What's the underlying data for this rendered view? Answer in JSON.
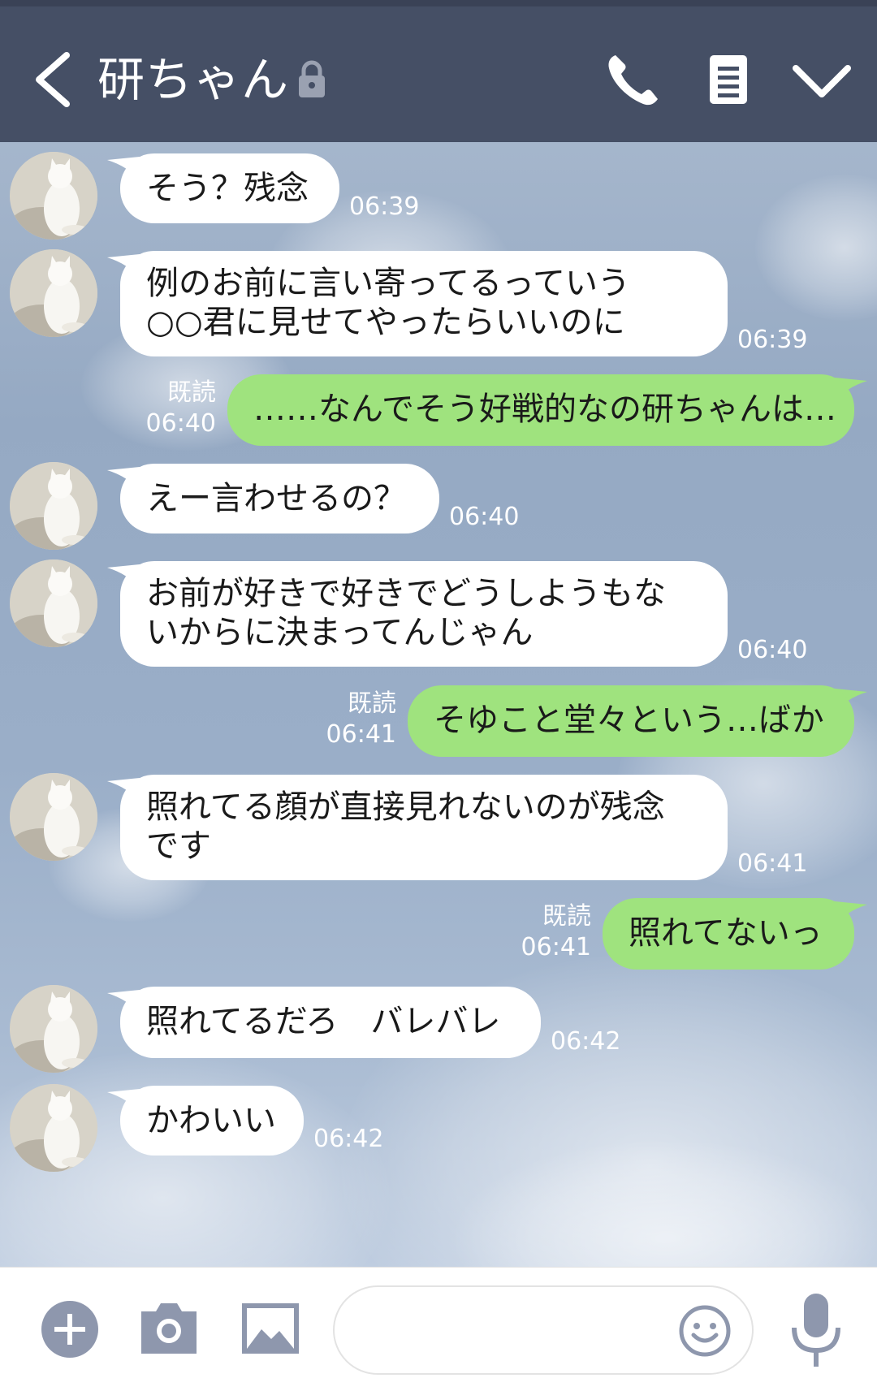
{
  "header": {
    "title": "研ちゃん",
    "icons": [
      "back-icon",
      "lock-icon",
      "phone-icon",
      "menu-icon",
      "chevron-down-icon"
    ]
  },
  "messages": [
    {
      "dir": "in",
      "lines": [
        "そう？残念"
      ],
      "time": "06:39"
    },
    {
      "dir": "in",
      "lines": [
        "例のお前に言い寄ってるっていう",
        "○○君に見せてやったらいいのに"
      ],
      "time": "06:39"
    },
    {
      "dir": "out",
      "lines": [
        "……なんでそう好戦的なの研ちゃんは…"
      ],
      "time": "06:40",
      "read": "既読"
    },
    {
      "dir": "in",
      "lines": [
        "えー言わせるの？"
      ],
      "time": "06:40"
    },
    {
      "dir": "in",
      "lines": [
        "お前が好きで好きでどうしようもな",
        "いからに決まってんじゃん"
      ],
      "time": "06:40"
    },
    {
      "dir": "out",
      "lines": [
        "そゆこと堂々という…ばか"
      ],
      "time": "06:41",
      "read": "既読"
    },
    {
      "dir": "in",
      "lines": [
        "照れてる顔が直接見れないのが残念",
        "です"
      ],
      "time": "06:41"
    },
    {
      "dir": "out",
      "lines": [
        "照れてないっ"
      ],
      "time": "06:41",
      "read": "既読"
    },
    {
      "dir": "in",
      "lines": [
        "照れてるだろ　バレバレ"
      ],
      "time": "06:42"
    },
    {
      "dir": "in",
      "lines": [
        "かわいい"
      ],
      "time": "06:42"
    }
  ],
  "input": {
    "placeholder": "",
    "icons": [
      "plus-icon",
      "camera-icon",
      "image-icon",
      "emoji-icon",
      "microphone-icon"
    ]
  },
  "colors": {
    "header_bg": "#454f65",
    "incoming_bubble": "#ffffff",
    "outgoing_bubble": "#9fe37e",
    "icon_gray": "#8e97ad"
  }
}
